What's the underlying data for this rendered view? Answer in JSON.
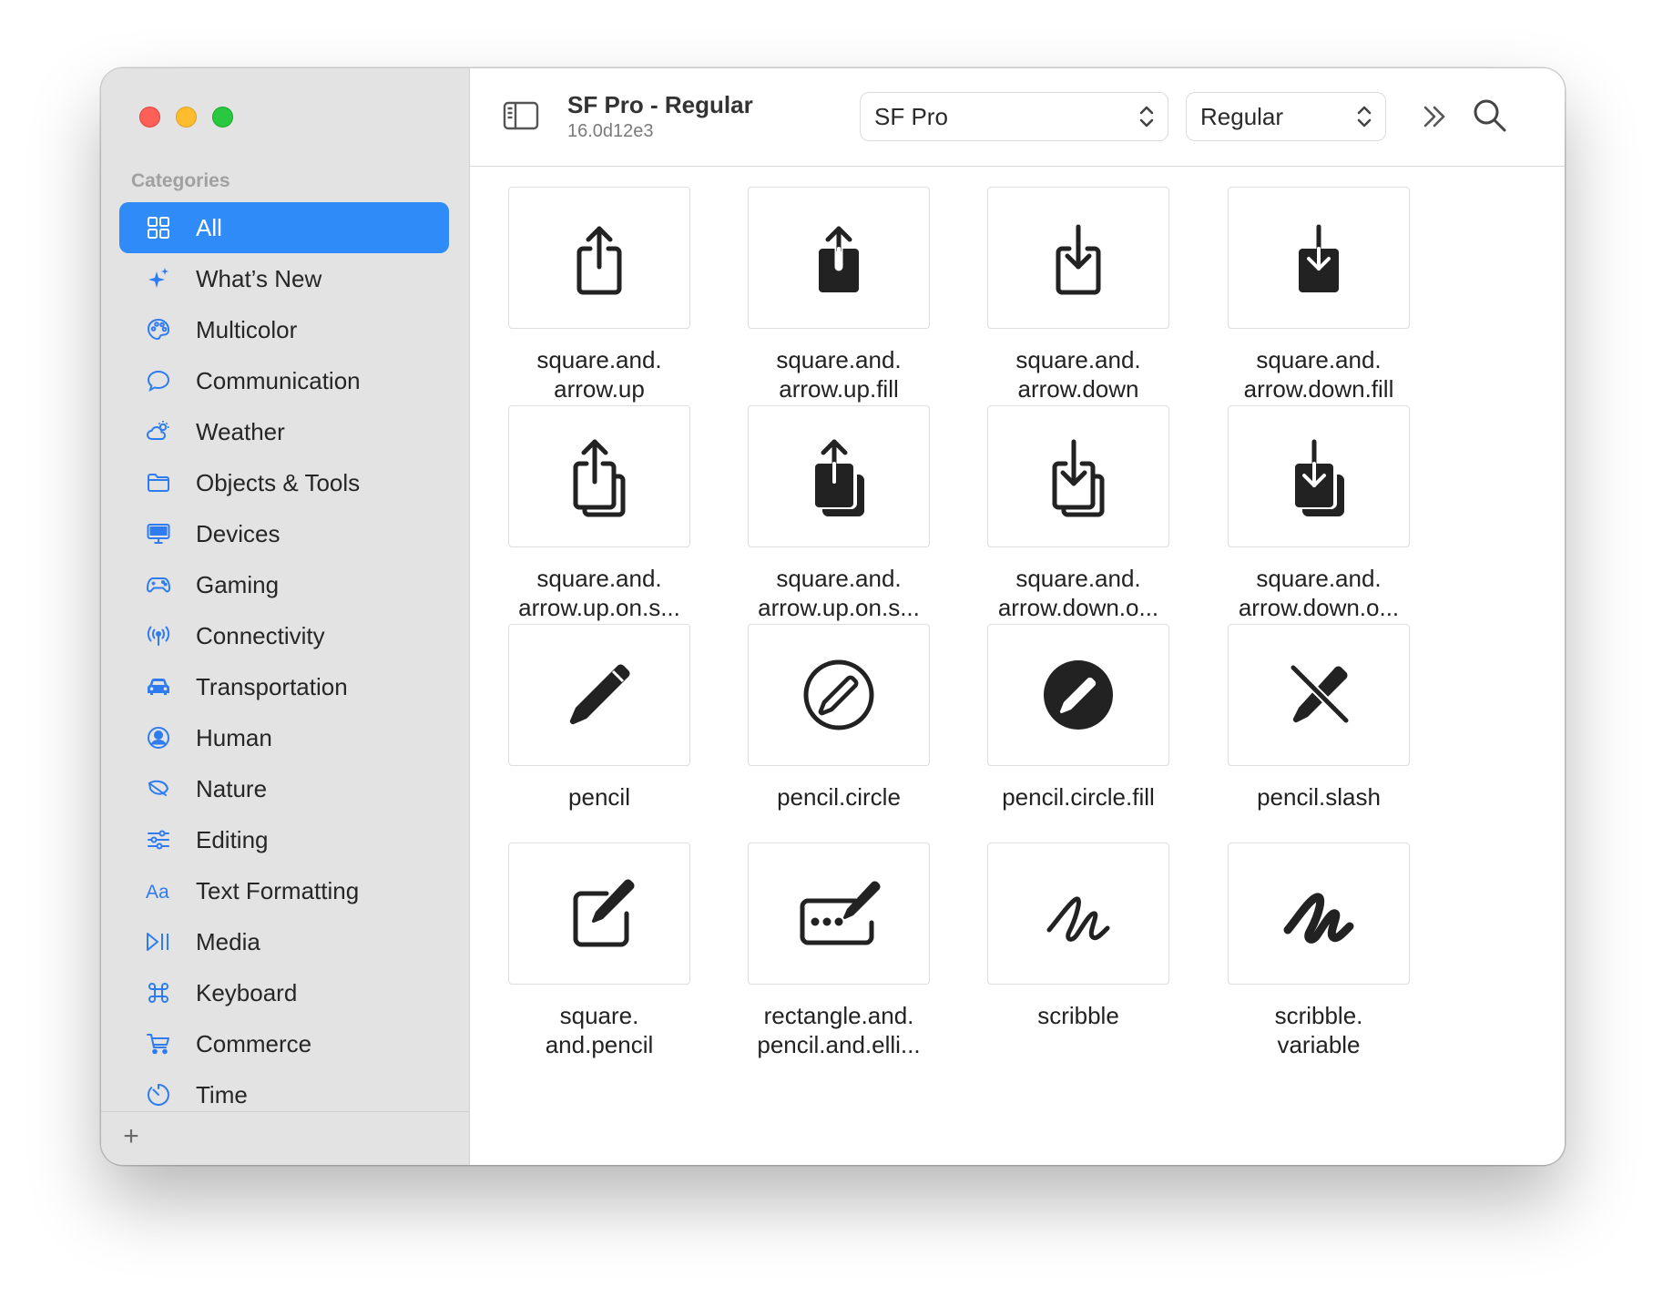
{
  "window": {
    "title": "SF Pro - Regular",
    "version": "16.0d12e3"
  },
  "sidebar": {
    "heading": "Categories",
    "items": [
      {
        "label": "All",
        "icon": "grid-icon",
        "active": true
      },
      {
        "label": "What’s New",
        "icon": "sparkles-icon"
      },
      {
        "label": "Multicolor",
        "icon": "paintpalette-icon"
      },
      {
        "label": "Communication",
        "icon": "message-icon"
      },
      {
        "label": "Weather",
        "icon": "cloud-sun-icon"
      },
      {
        "label": "Objects & Tools",
        "icon": "folder-icon"
      },
      {
        "label": "Devices",
        "icon": "desktopcomputer-icon"
      },
      {
        "label": "Gaming",
        "icon": "gamecontroller-icon"
      },
      {
        "label": "Connectivity",
        "icon": "antenna-icon"
      },
      {
        "label": "Transportation",
        "icon": "car-icon"
      },
      {
        "label": "Human",
        "icon": "person-circle-icon"
      },
      {
        "label": "Nature",
        "icon": "leaf-icon"
      },
      {
        "label": "Editing",
        "icon": "sliders-icon"
      },
      {
        "label": "Text Formatting",
        "icon": "textformat-icon"
      },
      {
        "label": "Media",
        "icon": "playpause-icon"
      },
      {
        "label": "Keyboard",
        "icon": "command-icon"
      },
      {
        "label": "Commerce",
        "icon": "cart-icon"
      },
      {
        "label": "Time",
        "icon": "timer-icon"
      }
    ],
    "add_label": "+"
  },
  "toolbar": {
    "font_select": "SF Pro",
    "weight_select": "Regular"
  },
  "symbols": [
    {
      "line1": "square.and.",
      "line2": "arrow.up",
      "icon": "square-and-arrow-up-icon"
    },
    {
      "line1": "square.and.",
      "line2": "arrow.up.fill",
      "icon": "square-and-arrow-up-fill-icon"
    },
    {
      "line1": "square.and.",
      "line2": "arrow.down",
      "icon": "square-and-arrow-down-icon"
    },
    {
      "line1": "square.and.",
      "line2": "arrow.down.fill",
      "icon": "square-and-arrow-down-fill-icon"
    },
    {
      "line1": "square.and.",
      "line2": "arrow.up.on.s...",
      "icon": "square-and-arrow-up-on-square-icon"
    },
    {
      "line1": "square.and.",
      "line2": "arrow.up.on.s...",
      "icon": "square-and-arrow-up-on-square-fill-icon"
    },
    {
      "line1": "square.and.",
      "line2": "arrow.down.o...",
      "icon": "square-and-arrow-down-on-square-icon"
    },
    {
      "line1": "square.and.",
      "line2": "arrow.down.o...",
      "icon": "square-and-arrow-down-on-square-fill-icon"
    },
    {
      "line1": "pencil",
      "line2": "",
      "icon": "pencil-icon"
    },
    {
      "line1": "pencil.circle",
      "line2": "",
      "icon": "pencil-circle-icon"
    },
    {
      "line1": "pencil.circle.fill",
      "line2": "",
      "icon": "pencil-circle-fill-icon"
    },
    {
      "line1": "pencil.slash",
      "line2": "",
      "icon": "pencil-slash-icon"
    },
    {
      "line1": "square.",
      "line2": "and.pencil",
      "icon": "square-and-pencil-icon"
    },
    {
      "line1": "rectangle.and.",
      "line2": "pencil.and.elli...",
      "icon": "rectangle-and-pencil-and-ellipsis-icon"
    },
    {
      "line1": "scribble",
      "line2": "",
      "icon": "scribble-icon"
    },
    {
      "line1": "scribble.",
      "line2": "variable",
      "icon": "scribble-variable-icon"
    }
  ]
}
